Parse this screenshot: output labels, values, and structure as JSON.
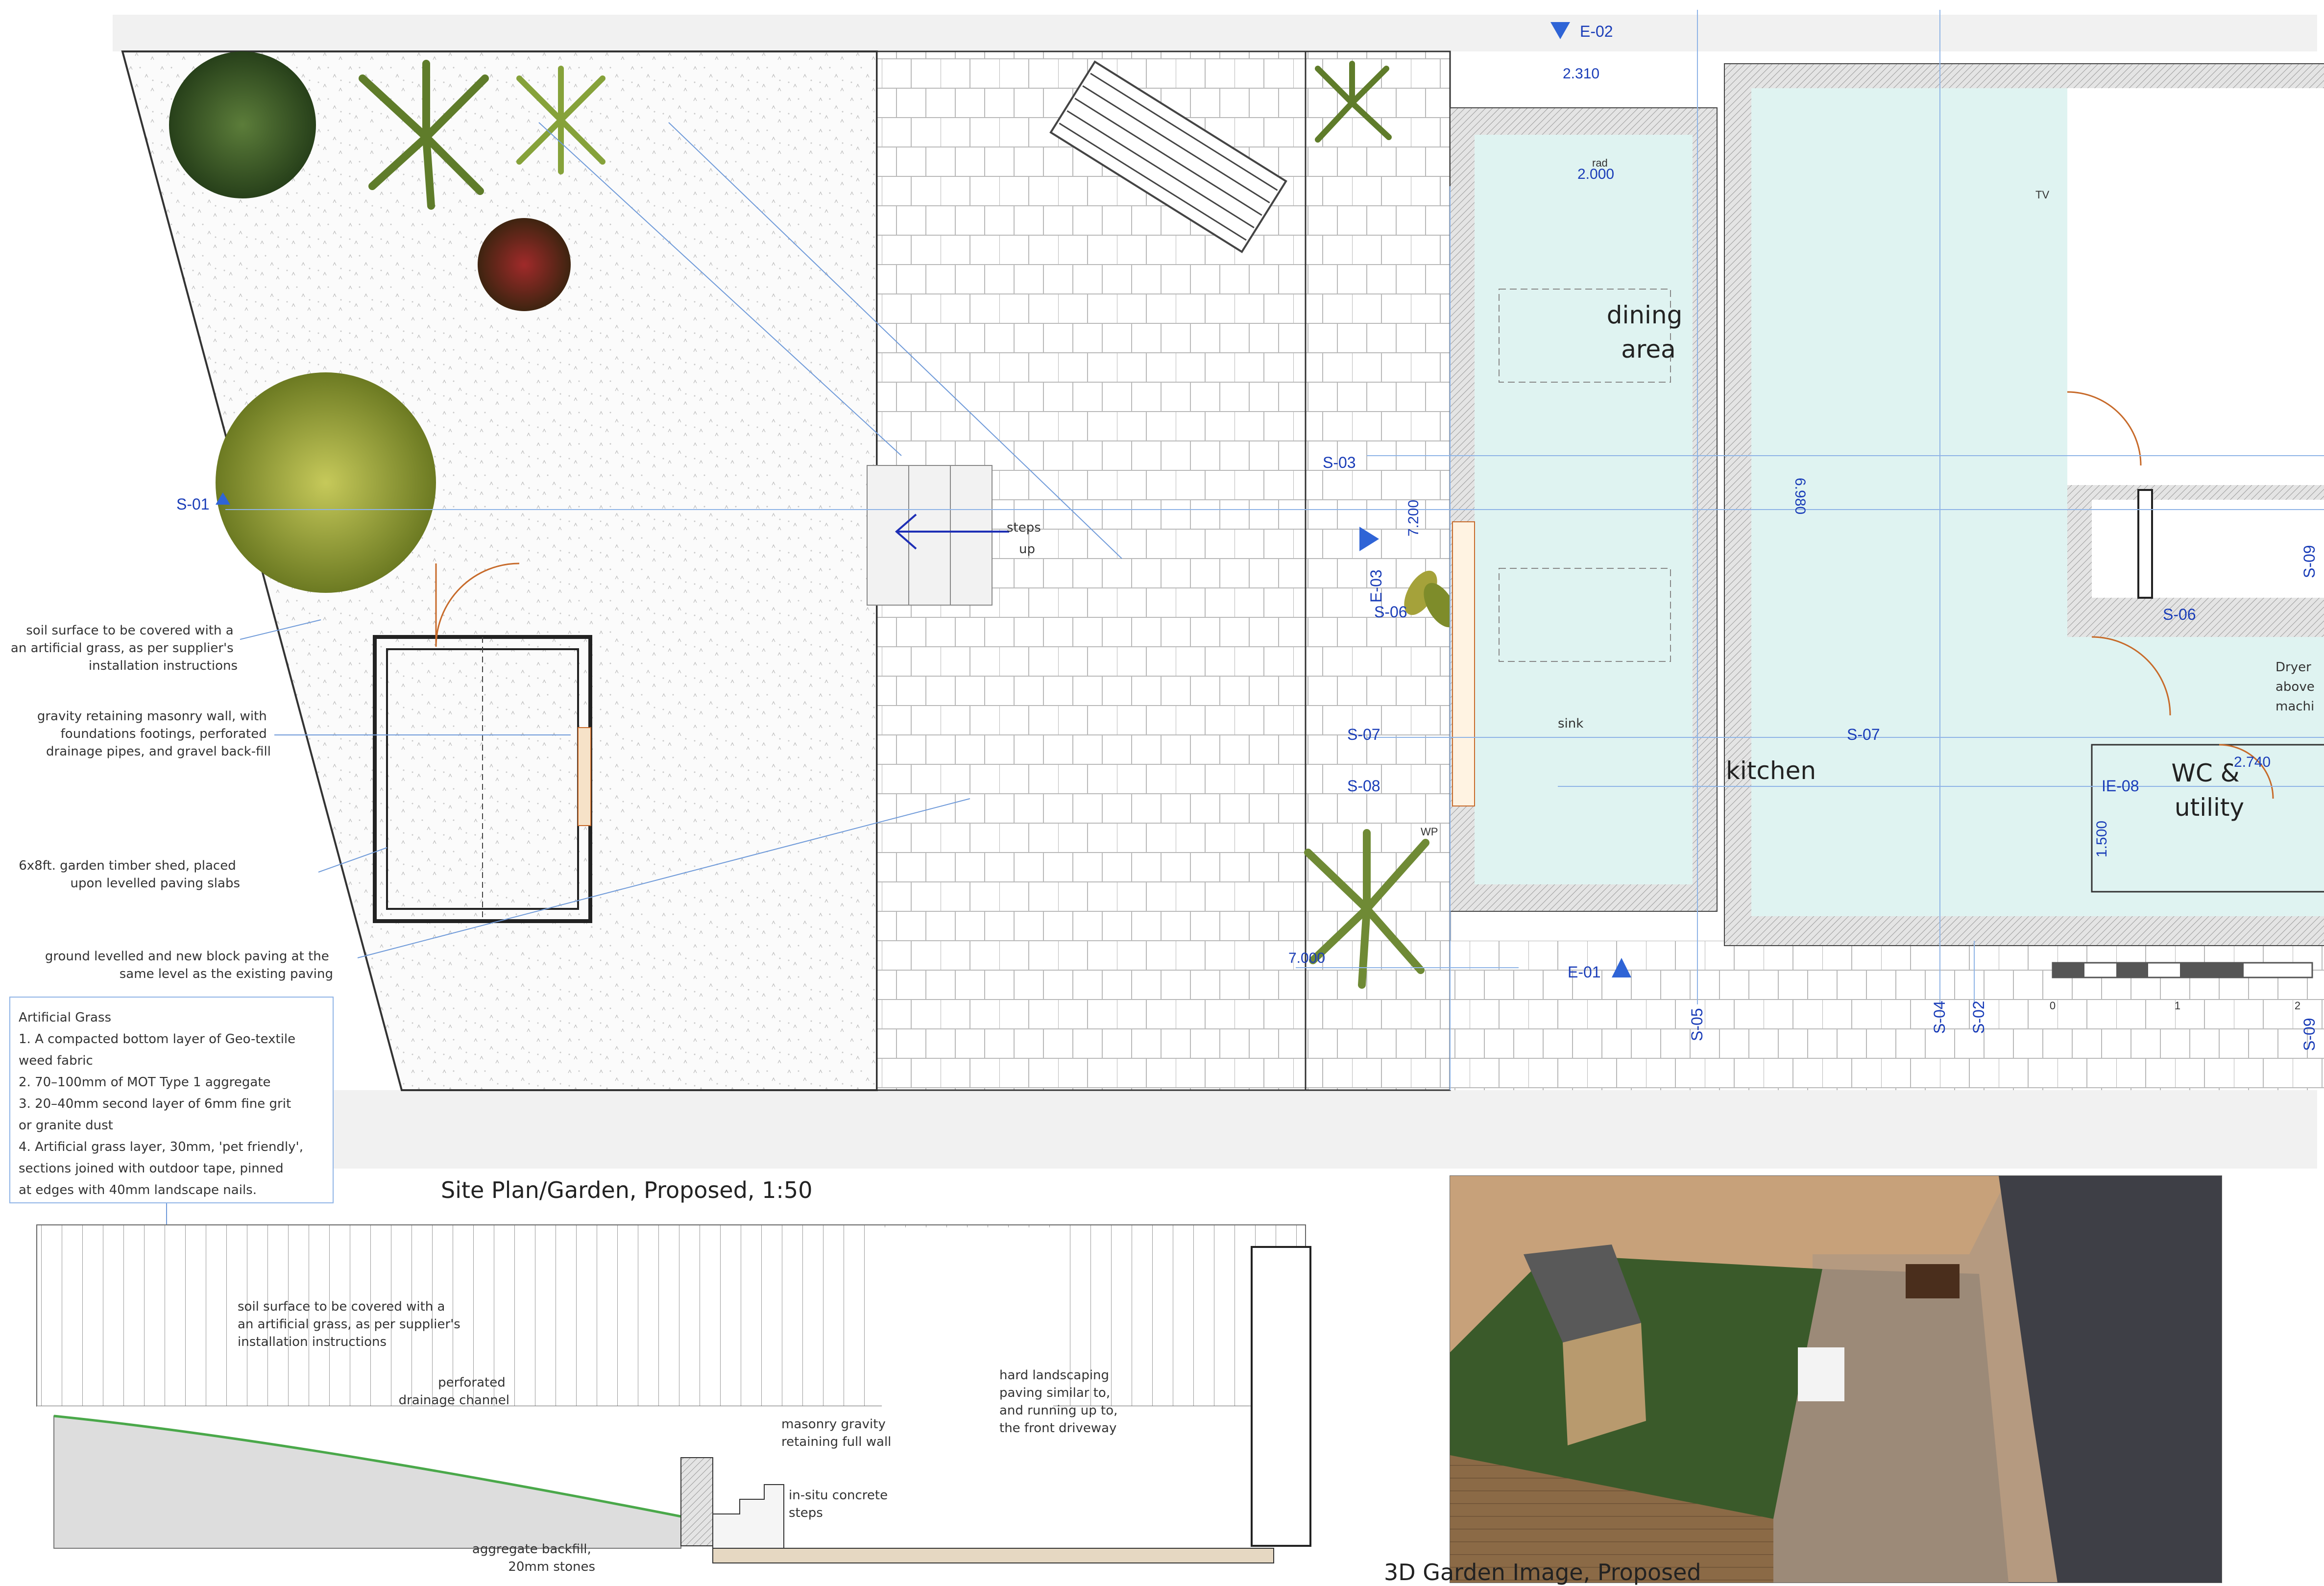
{
  "plan": {
    "title": "Site Plan/Garden, Proposed, 1:50",
    "annotations": [
      {
        "lines": [
          "soil surface to be covered with a",
          "an artificial grass, as per supplier's",
          "installation instructions"
        ]
      },
      {
        "lines": [
          "gravity retaining masonry wall, with",
          "foundations footings,  perforated",
          "drainage pipes, and gravel back-fill"
        ]
      },
      {
        "lines": [
          "6x8ft. garden timber shed, placed",
          "upon levelled paving slabs"
        ]
      },
      {
        "lines": [
          "ground levelled and new block paving at the",
          "same level as the existing paving"
        ]
      }
    ],
    "grass_spec": {
      "lines": [
        "Artificial Grass",
        "1. A compacted bottom layer of Geo-textile",
        "weed fabric",
        "2. 70–100mm of  MOT Type 1 aggregate",
        "3. 20–40mm second layer of 6mm fine grit",
        "or granite dust",
        "4. Artificial grass layer, 30mm, 'pet friendly',",
        "sections joined with outdoor tape, pinned",
        "at edges with 40mm landscape nails."
      ]
    },
    "steps_label": [
      "steps",
      "up"
    ],
    "rooms": {
      "dining": [
        "dining",
        "area"
      ],
      "kitchen": "kitchen",
      "wc": [
        "WC &",
        "utility"
      ],
      "sink": "sink",
      "wp": "WP",
      "tv": "TV",
      "rad": "rad",
      "dryer": [
        "Dryer",
        "above",
        "machi"
      ]
    },
    "dimensions": {
      "d1": "2.310",
      "d2": "2.000",
      "d3": "7.200",
      "d4": "6.980",
      "d5": "7.000",
      "d6": "2.740",
      "d7": "1.500"
    },
    "section_markers": {
      "e02": "E-02",
      "e01": "E-01",
      "e03": "E-03",
      "s01": "S-01",
      "s03": "S-03",
      "s06a": "S-06",
      "s06b": "S-06",
      "s07a": "S-07",
      "s07b": "S-07",
      "s08": "S-08",
      "ie08": "IE-08",
      "s05": "S-05",
      "s04": "S-04",
      "s02": "S-02",
      "s09a": "S-09",
      "s09b": "S-09"
    },
    "scale_bar": [
      "0",
      "1",
      "2"
    ]
  },
  "section": {
    "annotations": [
      {
        "lines": [
          "soil surface to be covered with a",
          "an artificial grass, as per supplier's",
          "installation instructions"
        ]
      },
      {
        "lines": [
          "perforated",
          "drainage channel"
        ]
      },
      {
        "lines": [
          "masonry gravity",
          "retaining full wall"
        ]
      },
      {
        "lines": [
          "in-situ concrete",
          "steps"
        ]
      },
      {
        "lines": [
          "aggregate  backfill,",
          "20mm stones"
        ]
      },
      {
        "lines": [
          "hard landscaping",
          "paving similar to,",
          "and running up to,",
          "the front driveway"
        ]
      }
    ]
  },
  "render": {
    "title": "3D Garden Image, Proposed"
  },
  "colors": {
    "room_fill": "#dff3f1",
    "wall_fill": "#d9d9d9",
    "marker_blue": "#2f64d6",
    "grass_green": "#3a5a2a",
    "paving": "#9c8a78"
  }
}
